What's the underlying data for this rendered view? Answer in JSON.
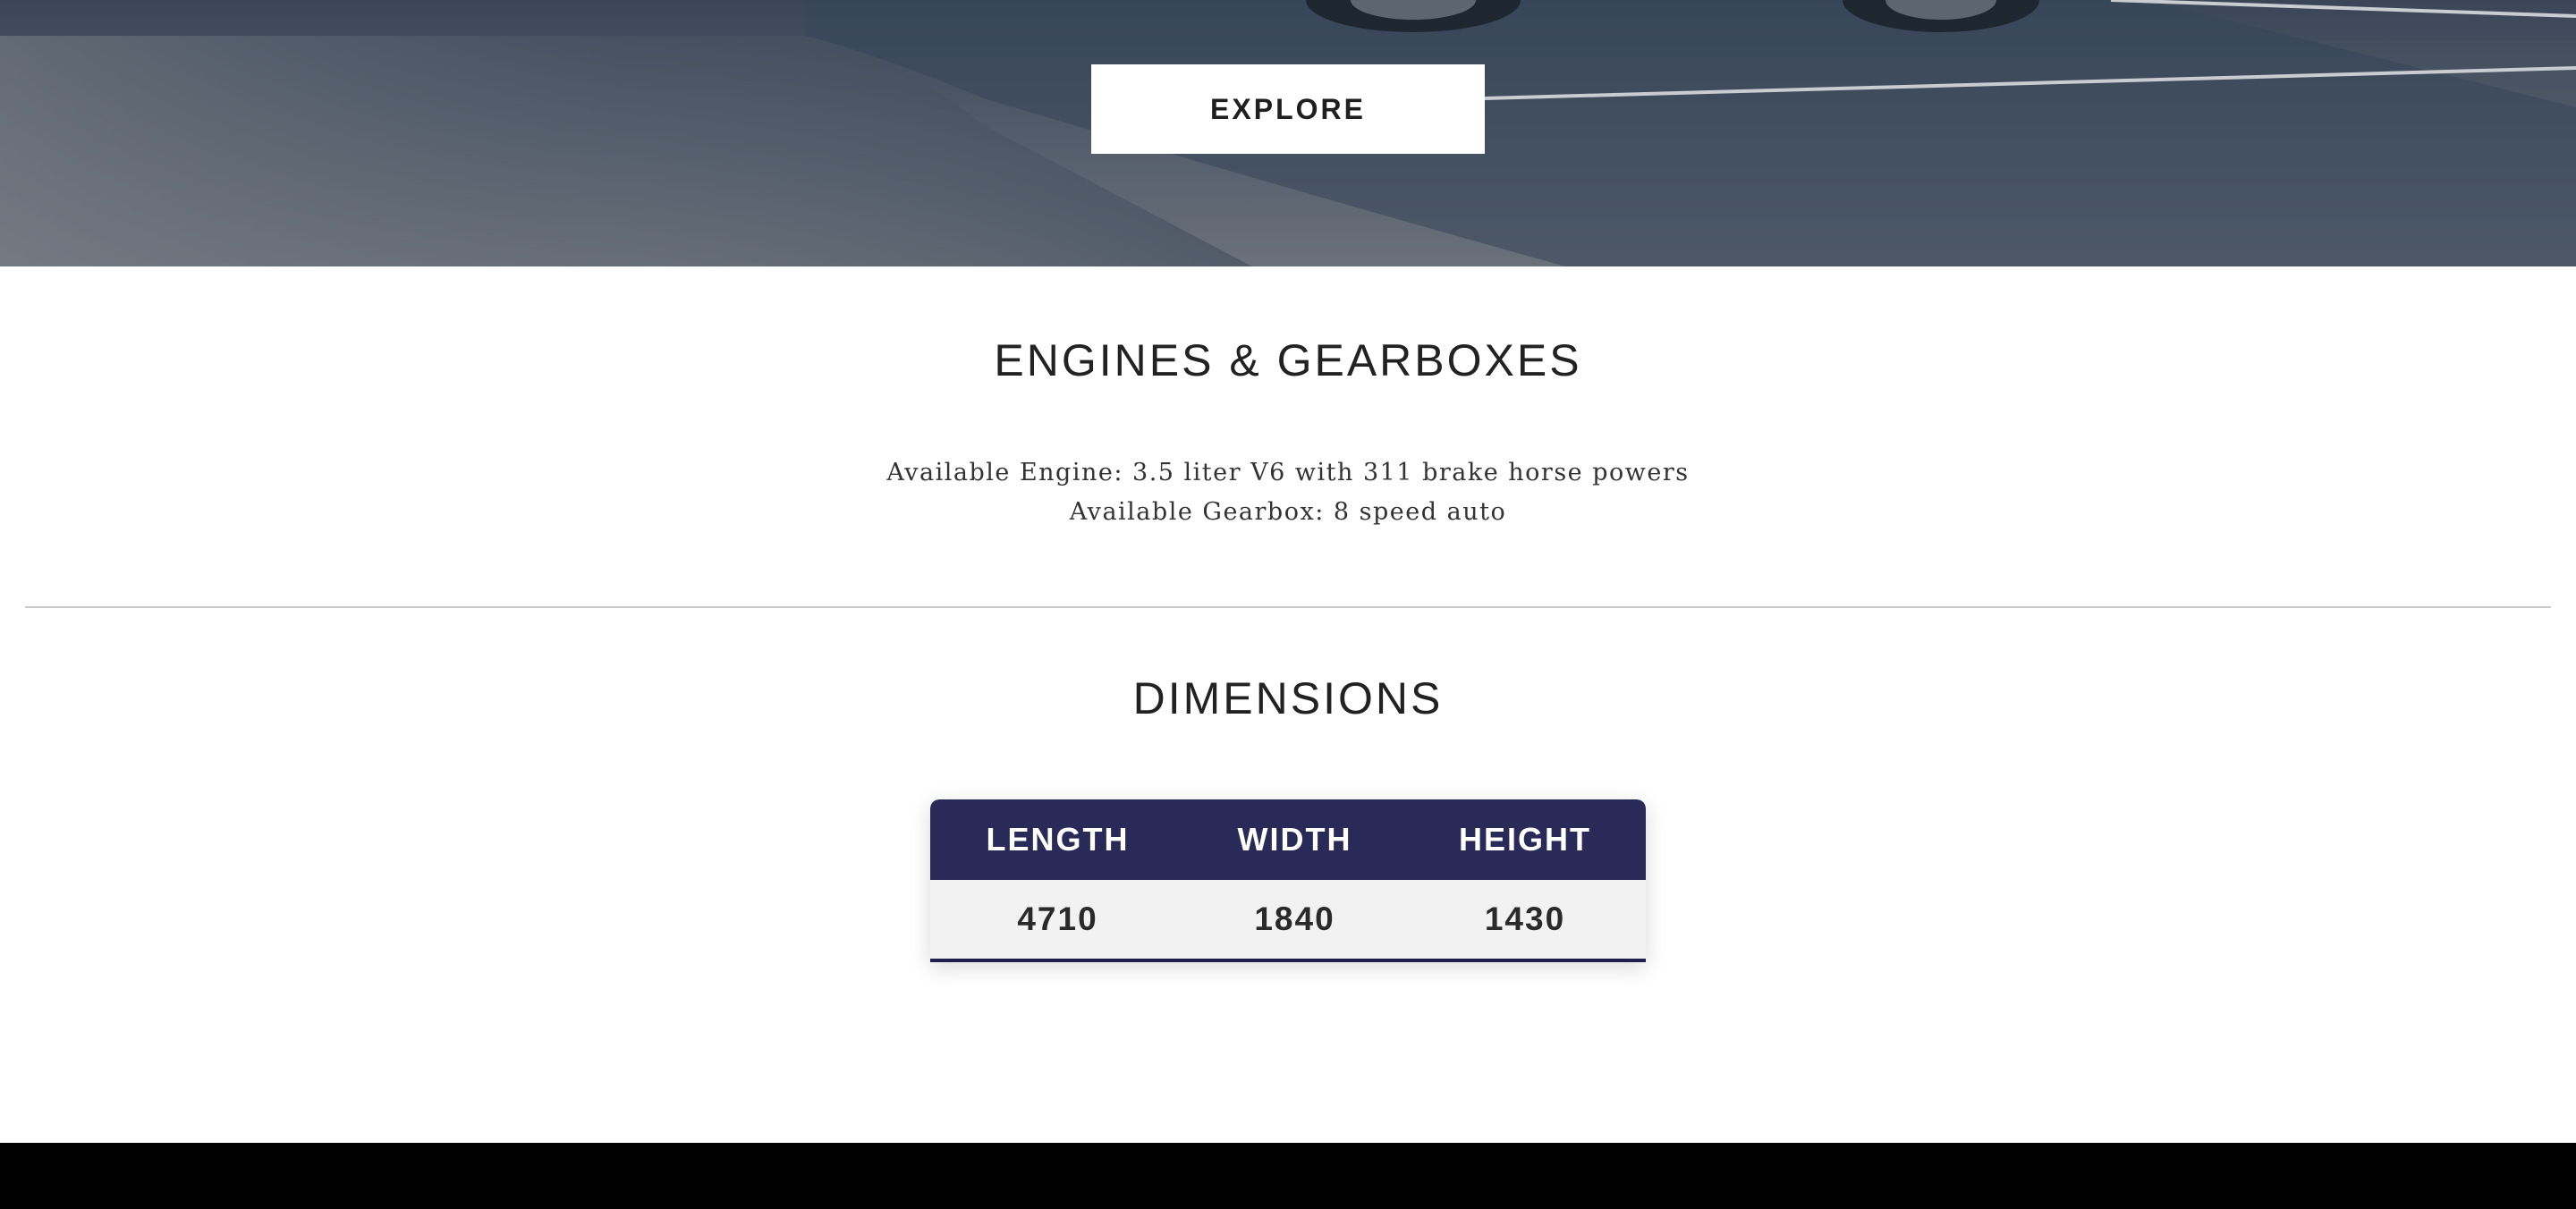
{
  "hero": {
    "explore_label": "EXPLORE"
  },
  "engines": {
    "title": "ENGINES & GEARBOXES",
    "engine_line": "Available Engine: 3.5 liter V6 with 311 brake horse powers",
    "gearbox_line": "Available Gearbox: 8 speed auto"
  },
  "dimensions": {
    "title": "DIMENSIONS",
    "headers": [
      "LENGTH",
      "WIDTH",
      "HEIGHT"
    ],
    "values": [
      "4710",
      "1840",
      "1430"
    ]
  },
  "colors": {
    "table_header": "#2a2a58",
    "footer": "#000000"
  }
}
